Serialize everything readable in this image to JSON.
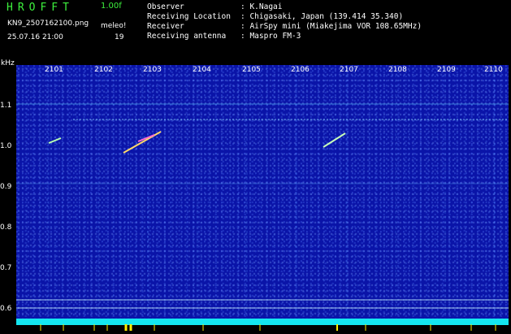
{
  "header": {
    "logo": "HROFFT",
    "version": "1.00f",
    "filename": "KN9_2507162100.png",
    "datetime": "25.07.16 21:00",
    "meleo_label": "meleo!",
    "meleo_value": "19",
    "info": [
      {
        "key": "Observer",
        "value": ": K.Nagai"
      },
      {
        "key": "Receiving Location",
        "value": ": Chigasaki, Japan (139.414 35.340)"
      },
      {
        "key": "Receiver",
        "value": ": AirSpy mini (Miakejima VOR 108.65MHz)"
      },
      {
        "key": "Receiving antenna",
        "value": ": Maspro FM-3"
      }
    ]
  },
  "y_axis": {
    "unit": "kHz",
    "ticks": [
      "1.1",
      "1.0",
      "0.9",
      "0.8",
      "0.7",
      "0.6"
    ]
  },
  "x_axis": {
    "ticks": [
      "2101",
      "2102",
      "2103",
      "2104",
      "2105",
      "2106",
      "2107",
      "2108",
      "2109",
      "2110"
    ]
  },
  "colors": {
    "background": "#000000",
    "plot": "#0a14a8",
    "logo": "#3df03d",
    "bottom_bar": "#14e6f0"
  }
}
